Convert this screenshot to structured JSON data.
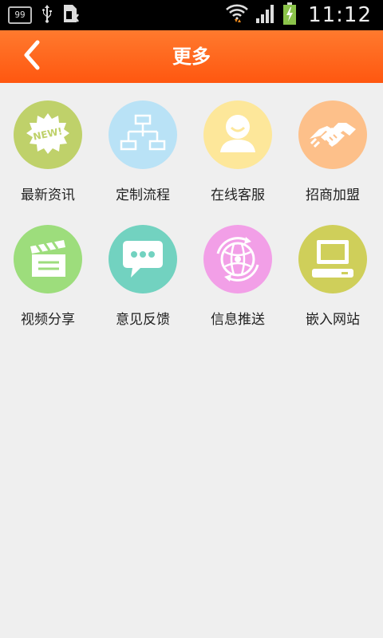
{
  "status_bar": {
    "notification_count": "99",
    "time": "11:12",
    "icons": [
      "notification-99-icon",
      "usb-icon",
      "sim-card-icon",
      "wifi-icon",
      "signal-icon",
      "battery-charging-icon"
    ]
  },
  "header": {
    "back_icon": "chevron-left-icon",
    "title": "更多",
    "background_color": "#ff5f1c"
  },
  "grid": {
    "items": [
      {
        "label": "最新资讯",
        "icon": "news-badge-icon",
        "color": "#bfd16a"
      },
      {
        "label": "定制流程",
        "icon": "flowchart-icon",
        "color": "#b9e2f6"
      },
      {
        "label": "在线客服",
        "icon": "customer-service-icon",
        "color": "#fde79a"
      },
      {
        "label": "招商加盟",
        "icon": "handshake-icon",
        "color": "#fdc08a"
      },
      {
        "label": "视频分享",
        "icon": "clapperboard-icon",
        "color": "#9ddd7c"
      },
      {
        "label": "意见反馈",
        "icon": "chat-bubble-icon",
        "color": "#72d2c0"
      },
      {
        "label": "信息推送",
        "icon": "push-globe-icon",
        "color": "#f29fe7"
      },
      {
        "label": "嵌入网站",
        "icon": "computer-icon",
        "color": "#cfcf5a"
      }
    ]
  }
}
